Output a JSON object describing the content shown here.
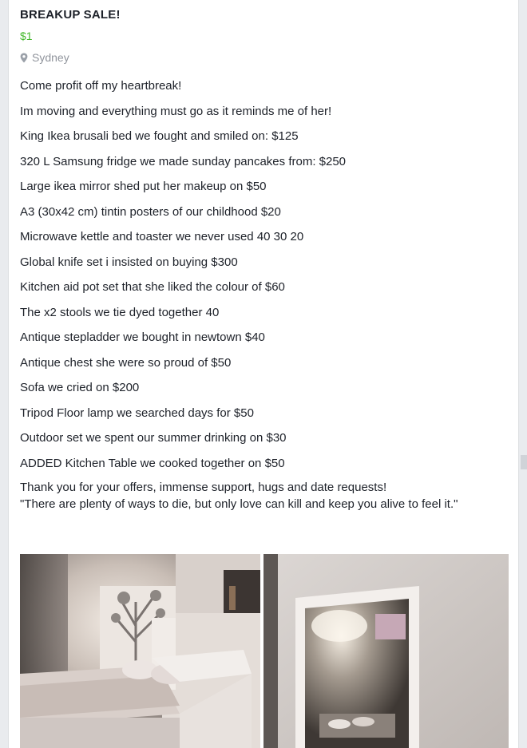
{
  "listing": {
    "title": "BREAKUP SALE!",
    "price": "$1",
    "location": "Sydney",
    "location_icon": "map-pin-icon"
  },
  "description": {
    "lines": [
      "Come profit off my heartbreak!",
      "Im moving and everything must go as it reminds me of her!",
      "King Ikea brusali bed we fought and smiled on: $125",
      "320 L Samsung fridge we made sunday pancakes from: $250",
      "Large ikea mirror shed put her makeup on $50",
      "A3 (30x42 cm) tintin posters of our childhood $20",
      "Microwave kettle and toaster we never used 40 30 20",
      "Global knife set i insisted on buying $300",
      "Kitchen aid pot set that she liked the colour of $60",
      "The x2 stools we tie dyed together 40",
      "Antique stepladder we bought in newtown $40",
      "Antique chest she were so proud of $50",
      "Sofa we cried on $200",
      "Tripod Floor lamp we searched days for $50",
      "Outdoor set we spent our summer drinking on $30",
      "ADDED Kitchen Table we cooked together on $50"
    ],
    "closing": [
      "Thank you for your offers, immense support, hugs and date requests!",
      "\"There are plenty of ways to die, but only love can kill and keep you alive to feel it.\""
    ]
  },
  "colors": {
    "price": "#42b72a",
    "muted": "#90949c",
    "text": "#1d2129"
  }
}
